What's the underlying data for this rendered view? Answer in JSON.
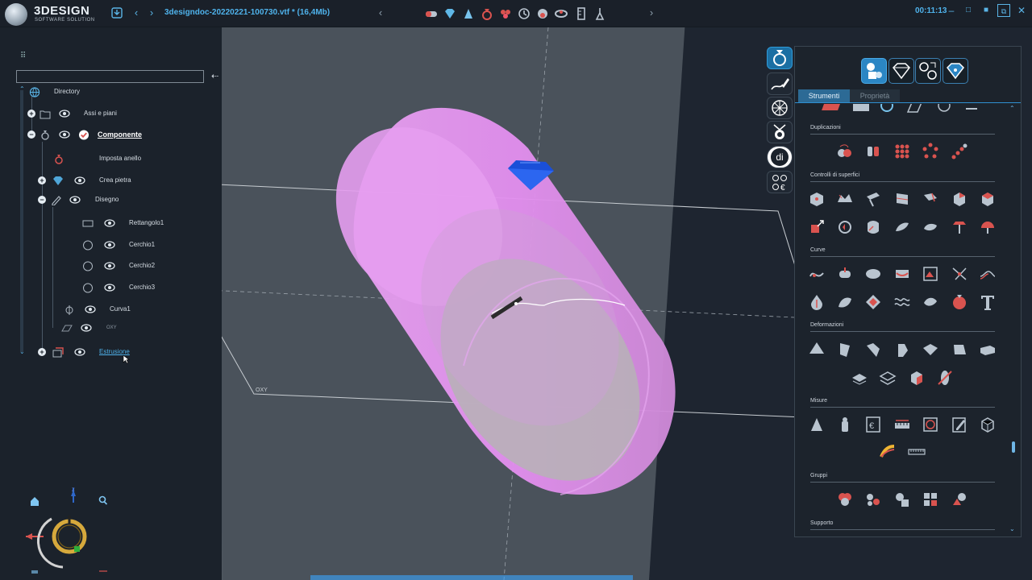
{
  "app": {
    "brand": "3DESIGN",
    "brand_sub": "SOFTWARE SOLUTION",
    "document_title": "3designdoc-20220221-100730.vtf * (16,4Mb)",
    "clock": "00:11:13"
  },
  "tree": {
    "root_label": "Directory",
    "items": [
      {
        "label": "Assi e piani"
      },
      {
        "label": "Componente"
      },
      {
        "label": "Imposta anello"
      },
      {
        "label": "Crea pietra"
      },
      {
        "label": "Disegno"
      },
      {
        "label": "Rettangolo1"
      },
      {
        "label": "Cerchio1"
      },
      {
        "label": "Cerchio2"
      },
      {
        "label": "Cerchio3"
      },
      {
        "label": "Curva1"
      },
      {
        "label": "OXY"
      },
      {
        "label": "Estrusione"
      }
    ]
  },
  "viewport": {
    "plane_label": "OXY",
    "axis_label_z": "Z"
  },
  "tools_panel": {
    "tabs": {
      "strumenti": "Strumenti",
      "proprieta": "Proprietà"
    },
    "right_toolbar_text": "di",
    "sections": [
      {
        "title": "Duplicazioni"
      },
      {
        "title": "Controlli di superfici"
      },
      {
        "title": "Curve"
      },
      {
        "title": "Deformazioni"
      },
      {
        "title": "Misure"
      },
      {
        "title": "Gruppi"
      },
      {
        "title": "Supporto"
      }
    ],
    "euro_symbol": "€"
  },
  "colors": {
    "accent": "#4fb3ec",
    "cylinder": "#e690f0",
    "gem": "#1a4fd8",
    "panel": "#1c232c"
  }
}
